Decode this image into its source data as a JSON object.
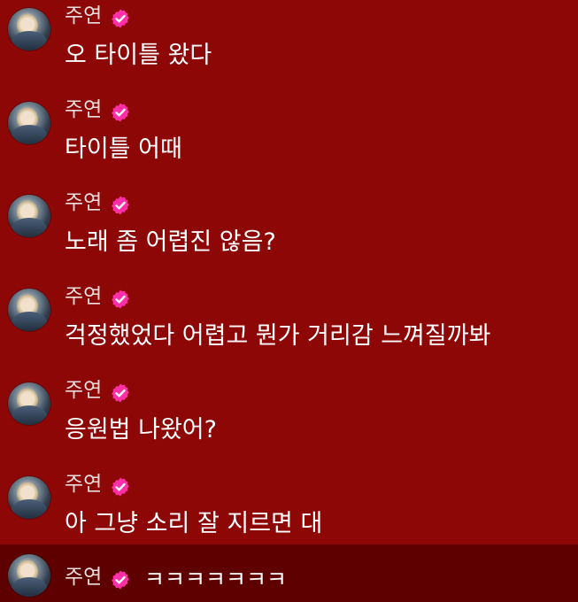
{
  "messages": [
    {
      "username": "주연",
      "verified_icon": "verified-badge-icon",
      "text": "오 타이틀 왔다"
    },
    {
      "username": "주연",
      "verified_icon": "verified-badge-icon",
      "text": "타이틀 어때"
    },
    {
      "username": "주연",
      "verified_icon": "verified-badge-icon",
      "text": "노래 좀 어렵진 않음?"
    },
    {
      "username": "주연",
      "verified_icon": "verified-badge-icon",
      "text": "걱정했었다 어렵고 뭔가 거리감 느껴질까봐"
    },
    {
      "username": "주연",
      "verified_icon": "verified-badge-icon",
      "text": "응원법 나왔어?"
    },
    {
      "username": "주연",
      "verified_icon": "verified-badge-icon",
      "text": "아 그냥 소리 잘 지르면 대"
    },
    {
      "username": "주연",
      "verified_icon": "verified-badge-icon",
      "text": "ㅋㅋㅋㅋㅋㅋㅋ"
    }
  ],
  "colors": {
    "background": "#8d0707",
    "highlight_background": "#5e0000",
    "badge": "#ff2fa8",
    "text": "#ffffff"
  }
}
